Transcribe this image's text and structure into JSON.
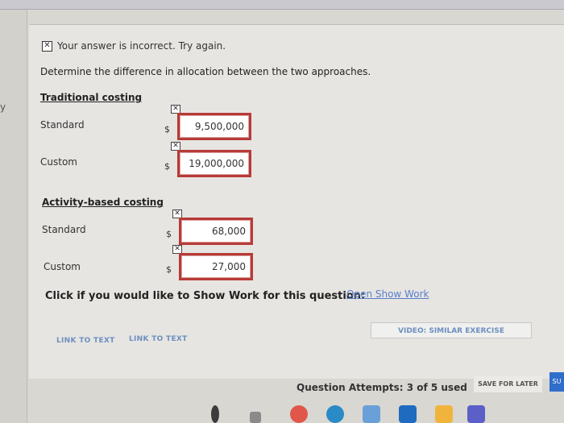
{
  "left": {
    "label": "y"
  },
  "feedback": {
    "text": "Your answer is incorrect.  Try again."
  },
  "question": {
    "text": "Determine the difference in allocation between the two approaches."
  },
  "traditional": {
    "title": "Traditional costing",
    "standard_label": "Standard",
    "standard_value": "9,500,000",
    "custom_label": "Custom",
    "custom_value": "19,000,000"
  },
  "activity": {
    "title": "Activity-based costing",
    "standard_label": "Standard",
    "standard_value": "68,000",
    "custom_label": "Custom",
    "custom_value": "27,000"
  },
  "currency_symbol": "$",
  "incorrect_mark": "✕",
  "show_work": {
    "prompt": "Click if you would like to Show Work for this question:",
    "link": "Open Show Work"
  },
  "links": {
    "link1": "LINK TO TEXT",
    "link2": "LINK TO TEXT",
    "video": "VIDEO: SIMILAR EXERCISE"
  },
  "footer": {
    "attempts": "Question Attempts: 3 of 5 used",
    "save_later": "SAVE FOR LATER",
    "submit": "SU"
  },
  "colors": {
    "error_border": "#b73a37",
    "link": "#5a7ec9",
    "submit": "#2f6ecb"
  },
  "icons": [
    "chrome-icon",
    "edge-icon",
    "store-icon",
    "mail-icon",
    "files-icon",
    "teams-icon"
  ]
}
